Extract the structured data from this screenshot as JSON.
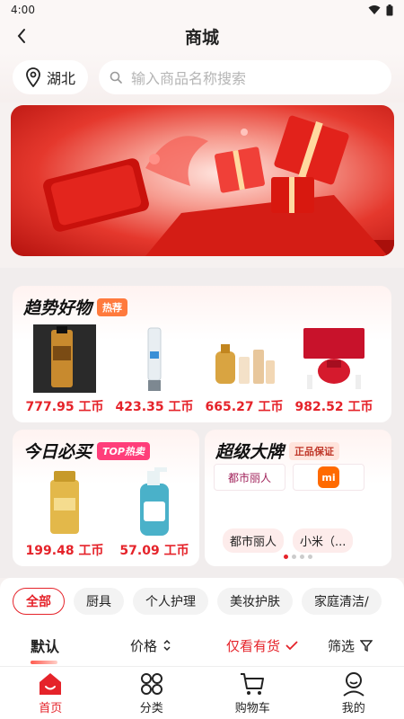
{
  "status_bar": {
    "time": "4:00"
  },
  "header": {
    "title": "商城"
  },
  "search": {
    "location": "湖北",
    "placeholder": "输入商品名称搜索"
  },
  "trend": {
    "title": "趋势好物",
    "tag": "热荐",
    "products": [
      {
        "price": "777.95 工币"
      },
      {
        "price": "423.35 工币"
      },
      {
        "price": "665.27 工币"
      },
      {
        "price": "982.52 工币"
      }
    ]
  },
  "today": {
    "title": "今日必买",
    "tag": "TOP热卖",
    "products": [
      {
        "price": "199.48 工币"
      },
      {
        "price": "57.09 工币"
      }
    ]
  },
  "brand": {
    "title": "超级大牌",
    "tag": "正品保证",
    "logo1": "都市丽人",
    "logo2": "mi",
    "names": [
      "都市丽人",
      "小米（..."
    ]
  },
  "categories": [
    "全部",
    "厨具",
    "个人护理",
    "美妆护肤",
    "家庭清洁/"
  ],
  "sort": {
    "default": "默认",
    "price": "价格",
    "in_stock": "仅看有货",
    "filter": "筛选"
  },
  "nav": [
    "首页",
    "分类",
    "购物车",
    "我的"
  ],
  "colors": {
    "accent": "#e5232a",
    "hot_tag": "#ff7a3d",
    "top_tag": "#ff3e7a"
  }
}
